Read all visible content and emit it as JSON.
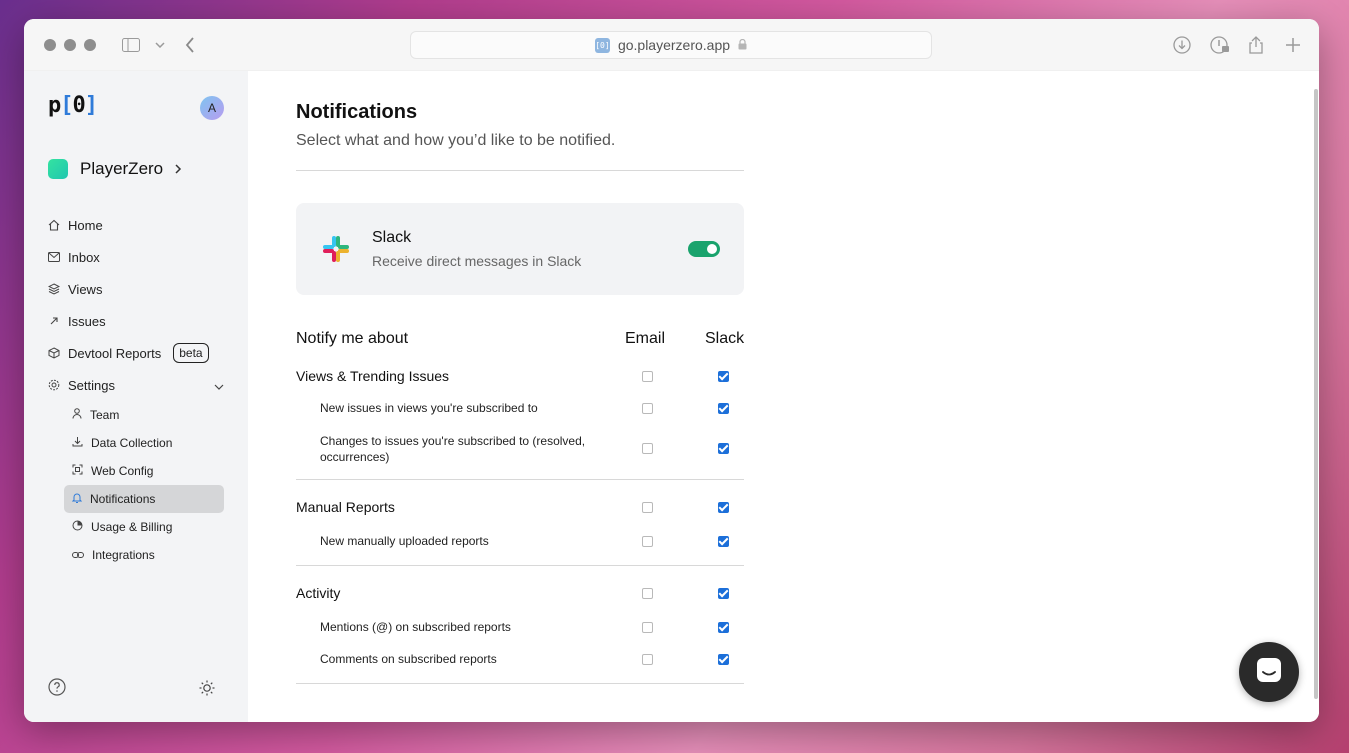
{
  "browser": {
    "url": "go.playerzero.app",
    "favicon_text": "[0]"
  },
  "sidebar": {
    "logo_left": "p",
    "logo_bracket_open": "[",
    "logo_zero": "0",
    "logo_bracket_close": "]",
    "avatar_initial": "A",
    "org_name": "PlayerZero",
    "items": [
      {
        "label": "Home",
        "icon": "home-icon"
      },
      {
        "label": "Inbox",
        "icon": "mail-icon"
      },
      {
        "label": "Views",
        "icon": "layers-icon"
      },
      {
        "label": "Issues",
        "icon": "arrow-up-right-icon"
      },
      {
        "label": "Devtool Reports",
        "icon": "cube-icon",
        "badge": "beta"
      },
      {
        "label": "Settings",
        "icon": "gear-icon"
      }
    ],
    "settings_items": [
      {
        "label": "Team",
        "icon": "person-icon"
      },
      {
        "label": "Data Collection",
        "icon": "download-icon"
      },
      {
        "label": "Web Config",
        "icon": "scan-icon"
      },
      {
        "label": "Notifications",
        "icon": "bell-icon",
        "active": true
      },
      {
        "label": "Usage & Billing",
        "icon": "pie-icon"
      },
      {
        "label": "Integrations",
        "icon": "link-icon"
      }
    ]
  },
  "page": {
    "title": "Notifications",
    "subtitle": "Select what and how you’d like to be notified."
  },
  "slack_card": {
    "title": "Slack",
    "description": "Receive direct messages in Slack",
    "enabled": true
  },
  "table": {
    "header": {
      "label": "Notify me about",
      "email": "Email",
      "slack": "Slack"
    },
    "groups": [
      {
        "label": "Views & Trending Issues",
        "email": false,
        "slack": true,
        "items": [
          {
            "label": "New issues in views you're subscribed to",
            "email": false,
            "slack": true
          },
          {
            "label_line1": "Changes to issues you're subscribed to (resolved,",
            "label_line2": "occurrences)",
            "email": false,
            "slack": true
          }
        ]
      },
      {
        "label": "Manual Reports",
        "email": false,
        "slack": true,
        "items": [
          {
            "label": "New manually uploaded reports",
            "email": false,
            "slack": true
          }
        ]
      },
      {
        "label": "Activity",
        "email": false,
        "slack": true,
        "items": [
          {
            "label": "Mentions (@) on subscribed reports",
            "email": false,
            "slack": true
          },
          {
            "label": "Comments on subscribed reports",
            "email": false,
            "slack": true
          }
        ]
      }
    ]
  },
  "colors": {
    "accent": "#1c6fd9",
    "toggle_on": "#1aa36d",
    "active_nav": "#d5d6d8"
  }
}
